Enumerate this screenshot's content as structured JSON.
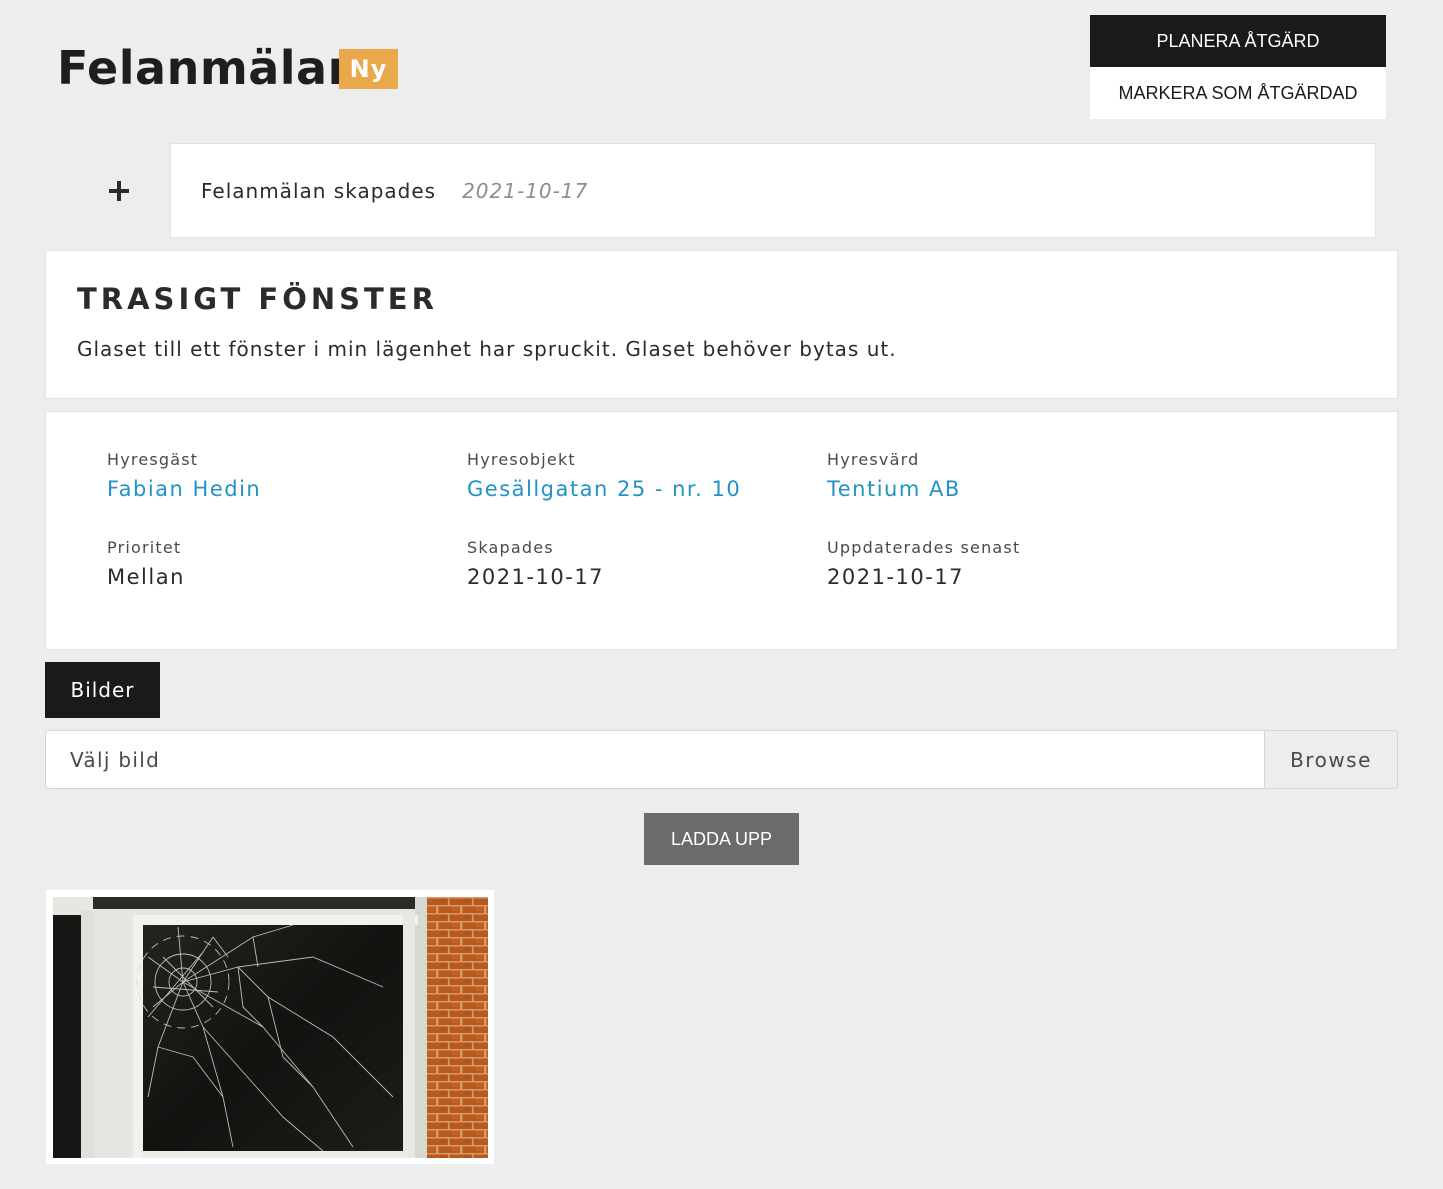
{
  "header": {
    "title": "Felanmälan",
    "status_badge": "Ny"
  },
  "actions": {
    "plan_label": "PLANERA ÅTGÄRD",
    "mark_done_label": "MARKERA SOM ÅTGÄRDAD"
  },
  "timeline": {
    "event_text": "Felanmälan skapades",
    "event_date": "2021-10-17"
  },
  "issue": {
    "title": "TRASIGT FÖNSTER",
    "description": "Glaset till ett fönster i min lägenhet har spruckit. Glaset behöver bytas ut."
  },
  "details": {
    "tenant": {
      "label": "Hyresgäst",
      "value": "Fabian Hedin"
    },
    "rental_object": {
      "label": "Hyresobjekt",
      "value": "Gesällgatan 25 - nr. 10"
    },
    "landlord": {
      "label": "Hyresvärd",
      "value": "Tentium AB"
    },
    "priority": {
      "label": "Prioritet",
      "value": "Mellan"
    },
    "created": {
      "label": "Skapades",
      "value": "2021-10-17"
    },
    "updated": {
      "label": "Uppdaterades senast",
      "value": "2021-10-17"
    }
  },
  "images": {
    "tab_label": "Bilder",
    "file_placeholder": "Välj bild",
    "browse_label": "Browse",
    "upload_label": "LADDA UPP"
  },
  "colors": {
    "badge": "#e9a94a",
    "link": "#2293c7",
    "dark_button": "#1a1a1a",
    "upload_button": "#6b6b6b",
    "background": "#ecedef"
  }
}
